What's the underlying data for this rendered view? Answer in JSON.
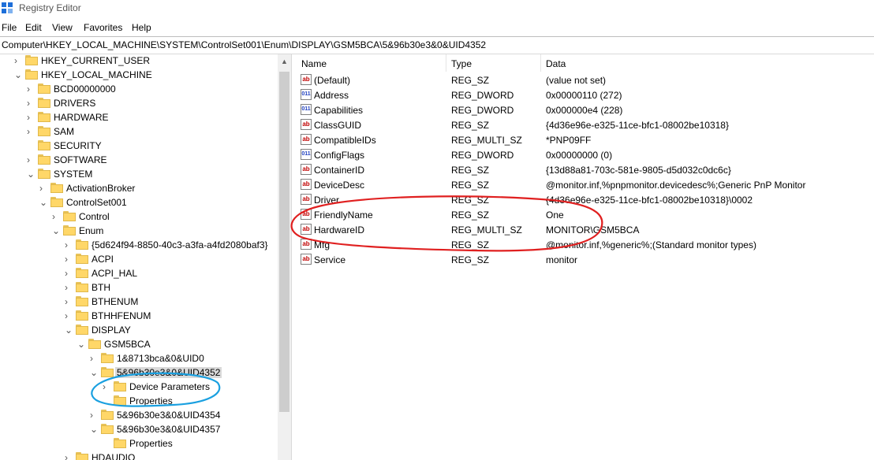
{
  "window": {
    "title": "Registry Editor",
    "icon": "registry-icon"
  },
  "menu": [
    "File",
    "Edit",
    "View",
    "Favorites",
    "Help"
  ],
  "address": "Computer\\HKEY_LOCAL_MACHINE\\SYSTEM\\ControlSet001\\Enum\\DISPLAY\\GSM5BCA\\5&96b30e3&0&UID4352",
  "tree": [
    {
      "label": "HKEY_CURRENT_USER",
      "expander": "right"
    },
    {
      "label": "HKEY_LOCAL_MACHINE",
      "expander": "down"
    },
    {
      "label": "BCD00000000",
      "expander": "right"
    },
    {
      "label": "DRIVERS",
      "expander": "right"
    },
    {
      "label": "HARDWARE",
      "expander": "right"
    },
    {
      "label": "SAM",
      "expander": "right"
    },
    {
      "label": "SECURITY",
      "expander": "none"
    },
    {
      "label": "SOFTWARE",
      "expander": "right"
    },
    {
      "label": "SYSTEM",
      "expander": "down"
    },
    {
      "label": "ActivationBroker",
      "expander": "right"
    },
    {
      "label": "ControlSet001",
      "expander": "down"
    },
    {
      "label": "Control",
      "expander": "right"
    },
    {
      "label": "Enum",
      "expander": "down"
    },
    {
      "label": "{5d624f94-8850-40c3-a3fa-a4fd2080baf3}",
      "expander": "right"
    },
    {
      "label": "ACPI",
      "expander": "right"
    },
    {
      "label": "ACPI_HAL",
      "expander": "right"
    },
    {
      "label": "BTH",
      "expander": "right"
    },
    {
      "label": "BTHENUM",
      "expander": "right"
    },
    {
      "label": "BTHHFENUM",
      "expander": "right"
    },
    {
      "label": "DISPLAY",
      "expander": "down"
    },
    {
      "label": "GSM5BCA",
      "expander": "down"
    },
    {
      "label": "1&8713bca&0&UID0",
      "expander": "right"
    },
    {
      "label": "5&96b30e3&0&UID4352",
      "expander": "down",
      "selected": true
    },
    {
      "label": "Device Parameters",
      "expander": "right"
    },
    {
      "label": "Properties",
      "expander": "none"
    },
    {
      "label": "5&96b30e3&0&UID4354",
      "expander": "right"
    },
    {
      "label": "5&96b30e3&0&UID4357",
      "expander": "down"
    },
    {
      "label": "Properties",
      "expander": "none"
    },
    {
      "label": "HDAUDIO",
      "expander": "right"
    }
  ],
  "columns": {
    "name": "Name",
    "type": "Type",
    "data": "Data"
  },
  "values": [
    {
      "name": "(Default)",
      "type": "REG_SZ",
      "data": "(value not set)",
      "icon": "string-value-icon"
    },
    {
      "name": "Address",
      "type": "REG_DWORD",
      "data": "0x00000110 (272)",
      "icon": "binary-value-icon"
    },
    {
      "name": "Capabilities",
      "type": "REG_DWORD",
      "data": "0x000000e4 (228)",
      "icon": "binary-value-icon"
    },
    {
      "name": "ClassGUID",
      "type": "REG_SZ",
      "data": "{4d36e96e-e325-11ce-bfc1-08002be10318}",
      "icon": "string-value-icon"
    },
    {
      "name": "CompatibleIDs",
      "type": "REG_MULTI_SZ",
      "data": "*PNP09FF",
      "icon": "string-value-icon"
    },
    {
      "name": "ConfigFlags",
      "type": "REG_DWORD",
      "data": "0x00000000 (0)",
      "icon": "binary-value-icon"
    },
    {
      "name": "ContainerID",
      "type": "REG_SZ",
      "data": "{13d88a81-703c-581e-9805-d5d032c0dc6c}",
      "icon": "string-value-icon"
    },
    {
      "name": "DeviceDesc",
      "type": "REG_SZ",
      "data": "@monitor.inf,%pnpmonitor.devicedesc%;Generic PnP Monitor",
      "icon": "string-value-icon"
    },
    {
      "name": "Driver",
      "type": "REG_SZ",
      "data": "{4d36e96e-e325-11ce-bfc1-08002be10318}\\0002",
      "icon": "string-value-icon"
    },
    {
      "name": "FriendlyName",
      "type": "REG_SZ",
      "data": "One",
      "icon": "string-value-icon"
    },
    {
      "name": "HardwareID",
      "type": "REG_MULTI_SZ",
      "data": "MONITOR\\GSM5BCA",
      "icon": "string-value-icon"
    },
    {
      "name": "Mfg",
      "type": "REG_SZ",
      "data": "@monitor.inf,%generic%;(Standard monitor types)",
      "icon": "string-value-icon"
    },
    {
      "name": "Service",
      "type": "REG_SZ",
      "data": "monitor",
      "icon": "string-value-icon"
    }
  ],
  "annotations": {
    "red_ellipse_color": "#e02020",
    "blue_ellipse_color": "#1aa0e0"
  }
}
